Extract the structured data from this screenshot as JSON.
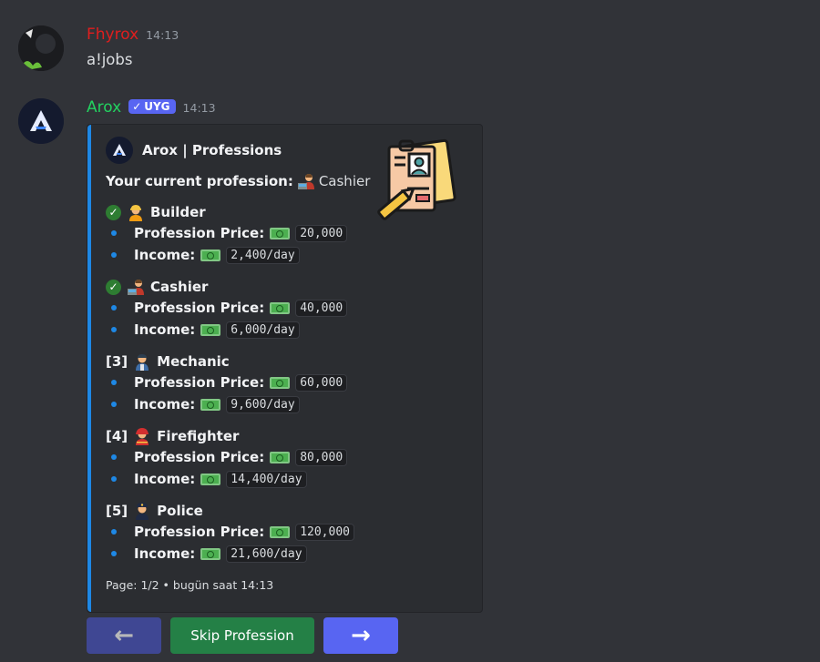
{
  "messages": [
    {
      "username": "Fhyrox",
      "timestamp": "14:13",
      "content": "a!jobs"
    },
    {
      "username": "Arox",
      "bot_tag": "UYG",
      "timestamp": "14:13",
      "embed": {
        "author": "Arox | Professions",
        "current_label": "Your current profession:",
        "current_value": "Cashier",
        "professions": [
          {
            "marker": "check",
            "name": "Builder",
            "price_label": "Profession Price:",
            "price": "20,000",
            "income_label": "Income:",
            "income": "2,400/day"
          },
          {
            "marker": "check",
            "name": "Cashier",
            "price_label": "Profession Price:",
            "price": "40,000",
            "income_label": "Income:",
            "income": "6,000/day"
          },
          {
            "marker": "[3]",
            "name": "Mechanic",
            "price_label": "Profession Price:",
            "price": "60,000",
            "income_label": "Income:",
            "income": "9,600/day"
          },
          {
            "marker": "[4]",
            "name": "Firefighter",
            "price_label": "Profession Price:",
            "price": "80,000",
            "income_label": "Income:",
            "income": "14,400/day"
          },
          {
            "marker": "[5]",
            "name": "Police",
            "price_label": "Profession Price:",
            "price": "120,000",
            "income_label": "Income:",
            "income": "21,600/day"
          }
        ],
        "footer": "Page: 1/2 • bugün saat 14:13"
      },
      "buttons": {
        "skip": "Skip Profession"
      }
    }
  ],
  "colors": {
    "background": "#313338",
    "embed_bg": "#2b2d31",
    "embed_accent": "#1e88e5",
    "blurple": "#5865f2",
    "success": "#248046"
  }
}
